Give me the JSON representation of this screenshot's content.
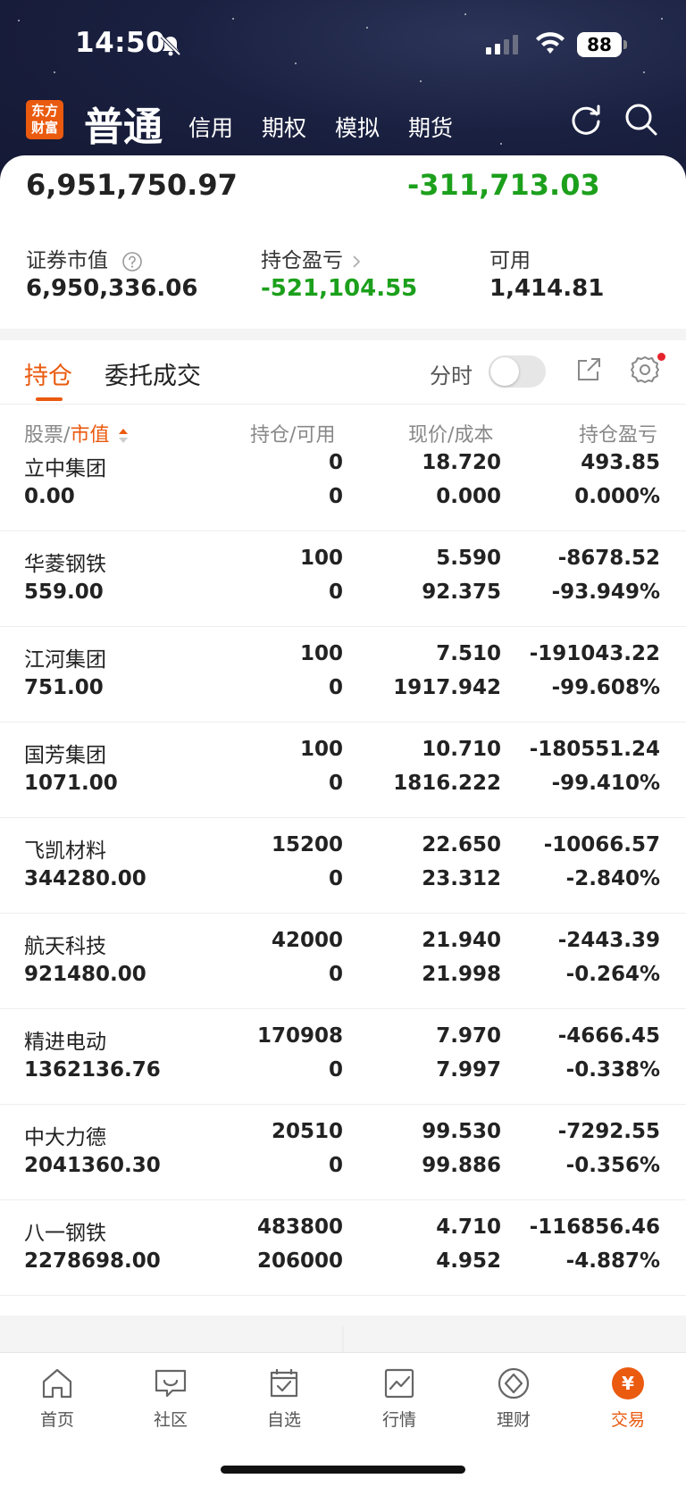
{
  "status": {
    "time": "14:50",
    "battery": "88"
  },
  "header": {
    "logo_lines": [
      "东方",
      "财富"
    ],
    "main_tab": "普通",
    "sub_tabs": [
      "信用",
      "期权",
      "模拟",
      "期货"
    ]
  },
  "summary": {
    "total_assets": "6,951,750.97",
    "total_pnl": "-311,713.03",
    "market_value_label": "证券市值",
    "market_value": "6,950,336.06",
    "position_pnl_label": "持仓盈亏",
    "position_pnl": "-521,104.55",
    "available_label": "可用",
    "available": "1,414.81"
  },
  "holdings": {
    "tab_active": "持仓",
    "tab_other": "委托成交",
    "fenshi_label": "分时",
    "columns": {
      "stock": "股票",
      "sep": "/",
      "market_value": "市值",
      "position": "持仓",
      "sep2": "/",
      "available": "可用",
      "price": "现价",
      "sep3": "/",
      "cost": "成本",
      "pnl": "持仓盈亏"
    },
    "rows": [
      {
        "name": "立中集团",
        "value": "0.00",
        "position": "0",
        "available": "0",
        "price": "18.720",
        "cost": "0.000",
        "pnl": "493.85",
        "pnl_pct": "0.000%",
        "dir": "up"
      },
      {
        "name": "华菱钢铁",
        "value": "559.00",
        "position": "100",
        "available": "0",
        "price": "5.590",
        "cost": "92.375",
        "pnl": "-8678.52",
        "pnl_pct": "-93.949%",
        "dir": "down"
      },
      {
        "name": "江河集团",
        "value": "751.00",
        "position": "100",
        "available": "0",
        "price": "7.510",
        "cost": "1917.942",
        "pnl": "-191043.22",
        "pnl_pct": "-99.608%",
        "dir": "down"
      },
      {
        "name": "国芳集团",
        "value": "1071.00",
        "position": "100",
        "available": "0",
        "price": "10.710",
        "cost": "1816.222",
        "pnl": "-180551.24",
        "pnl_pct": "-99.410%",
        "dir": "down"
      },
      {
        "name": "飞凯材料",
        "value": "344280.00",
        "position": "15200",
        "available": "0",
        "price": "22.650",
        "cost": "23.312",
        "pnl": "-10066.57",
        "pnl_pct": "-2.840%",
        "dir": "down"
      },
      {
        "name": "航天科技",
        "value": "921480.00",
        "position": "42000",
        "available": "0",
        "price": "21.940",
        "cost": "21.998",
        "pnl": "-2443.39",
        "pnl_pct": "-0.264%",
        "dir": "down"
      },
      {
        "name": "精进电动",
        "value": "1362136.76",
        "position": "170908",
        "available": "0",
        "price": "7.970",
        "cost": "7.997",
        "pnl": "-4666.45",
        "pnl_pct": "-0.338%",
        "dir": "down"
      },
      {
        "name": "中大力德",
        "value": "2041360.30",
        "position": "20510",
        "available": "0",
        "price": "99.530",
        "cost": "99.886",
        "pnl": "-7292.55",
        "pnl_pct": "-0.356%",
        "dir": "down"
      },
      {
        "name": "八一钢铁",
        "value": "2278698.00",
        "position": "483800",
        "available": "206000",
        "price": "4.710",
        "cost": "4.952",
        "pnl": "-116856.46",
        "pnl_pct": "-4.887%",
        "dir": "down"
      }
    ]
  },
  "bottom_nav": {
    "items": [
      {
        "label": "首页",
        "icon": "home-icon"
      },
      {
        "label": "社区",
        "icon": "chat-icon"
      },
      {
        "label": "自选",
        "icon": "favorites-icon"
      },
      {
        "label": "行情",
        "icon": "market-icon"
      },
      {
        "label": "理财",
        "icon": "wealth-icon"
      },
      {
        "label": "交易",
        "icon": "trade-icon"
      }
    ],
    "active_index": 5,
    "trade_symbol": "¥"
  },
  "colors": {
    "accent": "#ea5a0f",
    "up": "#e6232a",
    "down": "#1ca01c",
    "header_bg": "#1a2040"
  }
}
